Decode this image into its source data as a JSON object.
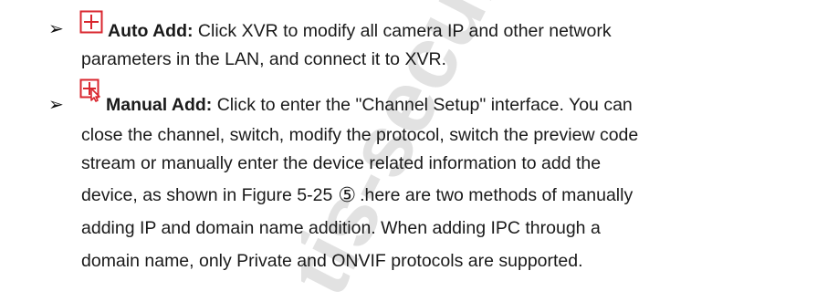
{
  "watermark": {
    "text": "tis-security",
    "color": "#d8d8d8"
  },
  "items": [
    {
      "icon": "auto-add-plus-icon",
      "title": "Auto Add:",
      "line1": "Click XVR to modify all camera IP and other network",
      "line2": "parameters in the LAN, and connect it to XVR."
    },
    {
      "icon": "manual-add-cursor-icon",
      "title": "Manual Add:",
      "line1": "Click to enter the \"Channel Setup\" interface. You can",
      "line2": "close the channel, switch, modify the protocol, switch the preview code",
      "line3": "stream or manually enter the device related information to add the",
      "line4_pre": "device, as shown in Figure 5-25",
      "line4_mark": "⑤",
      "line4_post": ".here are two methods of manually",
      "line5": "adding IP and domain name addition. When adding IPC through a",
      "line6": "domain name, only Private and ONVIF protocols are supported."
    }
  ],
  "colors": {
    "icon_red": "#d9262e",
    "text": "#1a1a1a"
  },
  "bullet_glyph": "➢"
}
